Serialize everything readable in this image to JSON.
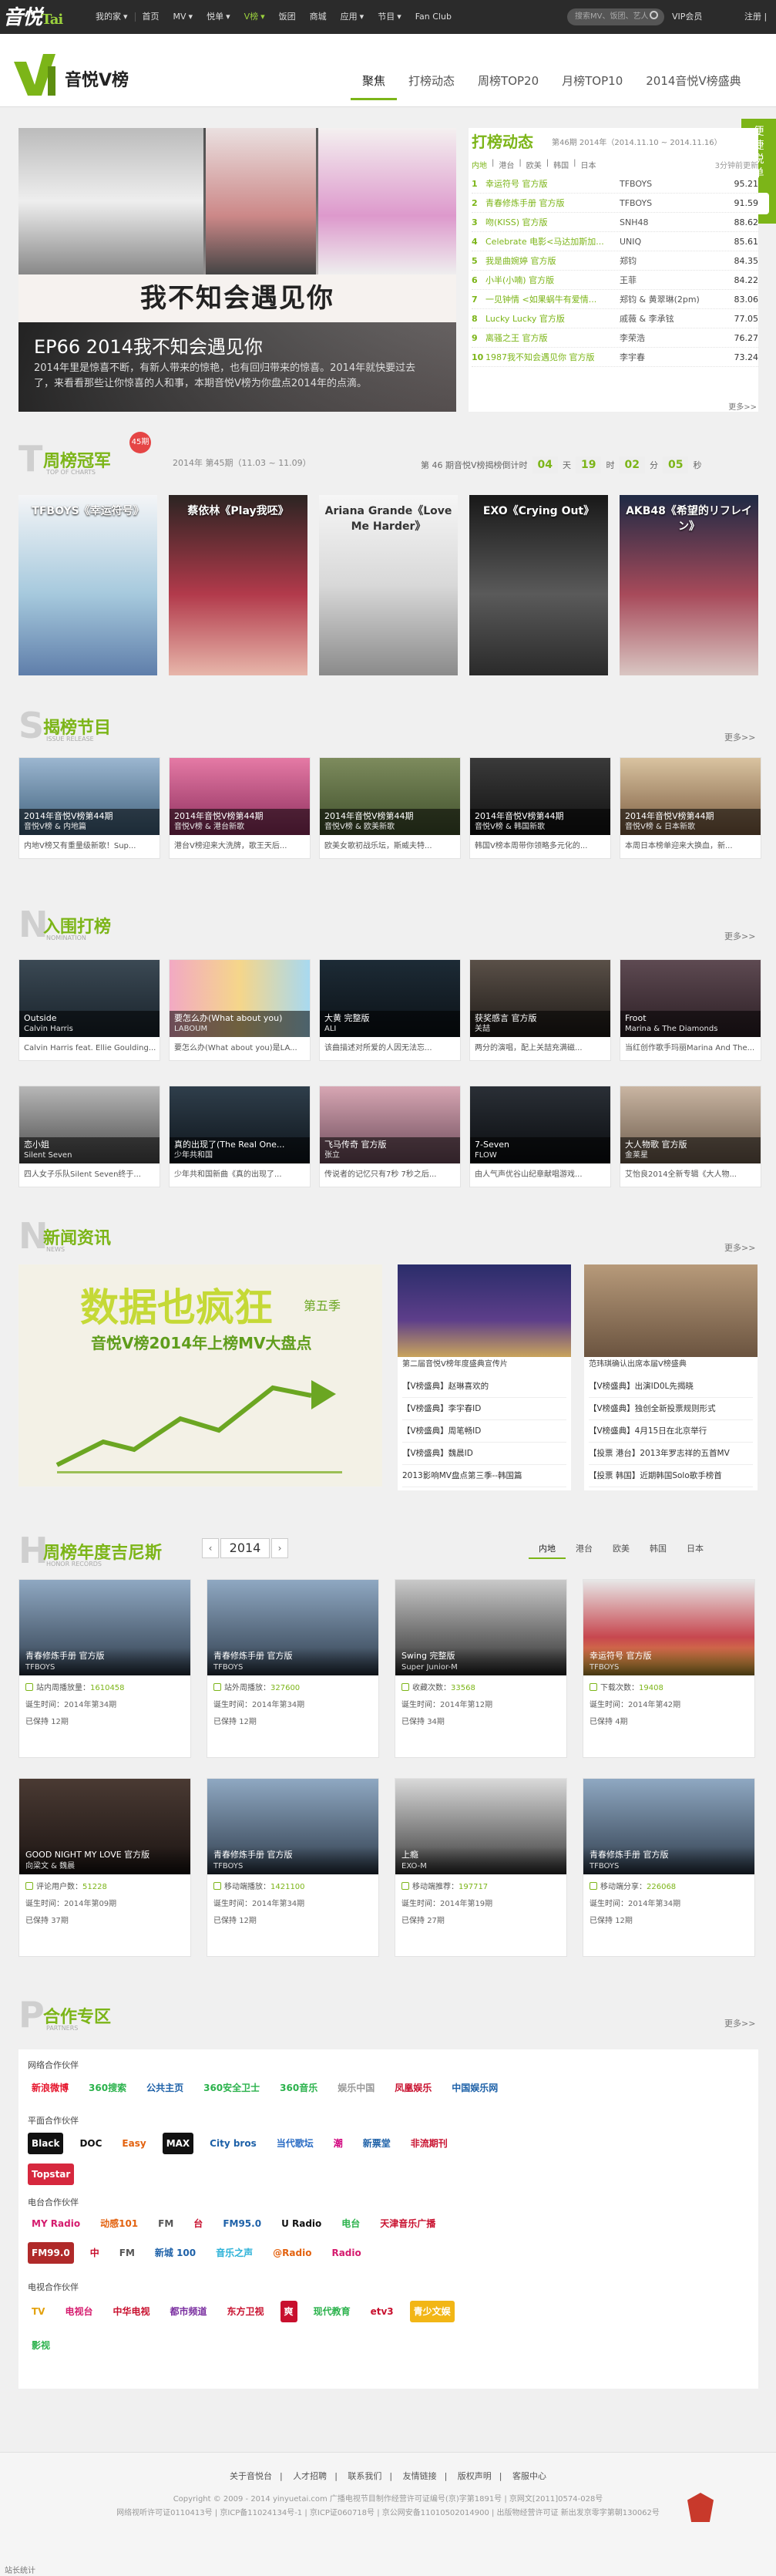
{
  "nav": {
    "logo": "音悦",
    "logo_suffix": "Tai",
    "items": [
      "我的家",
      "首页",
      "MV",
      "悦单",
      "V榜",
      "饭团",
      "商城",
      "应用",
      "节目",
      "Fan Club"
    ],
    "search_placeholder": "搜索MV、饭团、艺人",
    "vip": "VIP会员",
    "register": "注册",
    "login": "登录"
  },
  "header": {
    "title": "音悦V榜",
    "tabs": [
      "聚焦",
      "打榜动态",
      "周榜TOP20",
      "月榜TOP10",
      "2014音悦V榜盛典"
    ]
  },
  "float": {
    "label": "便捷悦单"
  },
  "hero": {
    "art_title": "我不知会遇见你",
    "title": "EP66 2014我不知会遇见你",
    "desc": "2014年里是惊喜不断，有新人带来的惊艳，也有回归带来的惊喜。2014年就快要过去了，来看看那些让你惊喜的人和事，本期音悦V榜为你盘点2014年的点滴。"
  },
  "rank": {
    "title": "打榜动态",
    "period": "第46期 2014年（2014.11.10 ~ 2014.11.16）",
    "regions": [
      "内地",
      "港台",
      "欧美",
      "韩国",
      "日本"
    ],
    "updated": "3分钟前更新",
    "rows": [
      {
        "n": "1",
        "song": "幸运符号 官方版",
        "artist": "TFBOYS",
        "score": "95.21"
      },
      {
        "n": "2",
        "song": "青春修炼手册 官方版",
        "artist": "TFBOYS",
        "score": "91.59"
      },
      {
        "n": "3",
        "song": "吻(KISS) 官方版",
        "artist": "SNH48",
        "score": "88.62"
      },
      {
        "n": "4",
        "song": "Celebrate 电影<马达加斯加...",
        "artist": "UNIQ",
        "score": "85.61"
      },
      {
        "n": "5",
        "song": "我是曲婉婷 官方版",
        "artist": "郑钧",
        "score": "84.35"
      },
      {
        "n": "6",
        "song": "小半(小喃) 官方版",
        "artist": "王菲",
        "score": "84.22"
      },
      {
        "n": "7",
        "song": "一见钟情 <如果蜗牛有爱情...",
        "artist": "郑钧 & 黄翠琳(2pm)",
        "score": "83.06"
      },
      {
        "n": "8",
        "song": "Lucky Lucky 官方版",
        "artist": "戚薇 & 李承铉",
        "score": "77.05"
      },
      {
        "n": "9",
        "song": "离骚之王 官方版",
        "artist": "李荣浩",
        "score": "76.27"
      },
      {
        "n": "10",
        "song": "1987我不知会遇见你 官方版",
        "artist": "李宇春",
        "score": "73.24"
      }
    ],
    "more": "更多>>"
  },
  "weekly": {
    "title_cn": "周榜冠军",
    "title_en": "TOP OF CHARTS",
    "badge": "45期",
    "period": "2014年 第45期（11.03 ~ 11.09）",
    "countdown_label": "第 46 期音悦V榜揭榜倒计时",
    "days": "04",
    "days_unit": "天",
    "hours": "19",
    "hours_unit": "时",
    "mins": "02",
    "mins_unit": "分",
    "secs": "05",
    "secs_unit": "秒",
    "champions": [
      {
        "label": "TFBOYS《幸运符号》"
      },
      {
        "label": "蔡依林《Play我呸》"
      },
      {
        "label": "Ariana Grande《Love Me Harder》"
      },
      {
        "label": "EXO《Crying Out》"
      },
      {
        "label": "AKB48《希望的リフレイン》"
      }
    ]
  },
  "programs": {
    "title_cn": "揭榜节目",
    "title_en": "ISSUE RELEASE",
    "more": "更多>>",
    "items": [
      {
        "ov": "2014年音悦V榜第44期",
        "sub": "音悦V榜 & 内地篇",
        "desc": "内地V榜又有重量级新歌！Sup..."
      },
      {
        "ov": "2014年音悦V榜第44期",
        "sub": "音悦V榜 & 港台新歌",
        "desc": "港台V榜迎来大洗牌，歌王天后..."
      },
      {
        "ov": "2014年音悦V榜第44期",
        "sub": "音悦V榜 & 欧美新歌",
        "desc": "欧美女歌初战乐坛，斯威夫特..."
      },
      {
        "ov": "2014年音悦V榜第44期",
        "sub": "音悦V榜 & 韩国新歌",
        "desc": "韩国V榜本周带你领略多元化的..."
      },
      {
        "ov": "2014年音悦V榜第44期",
        "sub": "音悦V榜 & 日本新歌",
        "desc": "本周日本榜单迎来大换血，新..."
      }
    ]
  },
  "candidates": {
    "title_cn": "入围打榜",
    "title_en": "NOMINATION",
    "more": "更多>>",
    "items": [
      {
        "ov": "Outside",
        "sub": "Calvin Harris",
        "desc": "Calvin Harris feat. Ellie Goulding..."
      },
      {
        "ov": "要怎么办(What about you)",
        "sub": "LABOUM",
        "desc": "要怎么办(What about you)是LA..."
      },
      {
        "ov": "大黄 完整版",
        "sub": "ALI",
        "desc": "该曲描述对所爱的人因无法忘..."
      },
      {
        "ov": "获奖感言 官方版",
        "sub": "关喆",
        "desc": "两分的演唱，配上关喆充满磁..."
      },
      {
        "ov": "Froot",
        "sub": "Marina & The Diamonds",
        "desc": "当红创作歌手玛丽Marina And The..."
      },
      {
        "ov": "恋小姐",
        "sub": "Silent Seven",
        "desc": "四人女子乐队Silent Seven终于..."
      },
      {
        "ov": "真的出现了(The Real One...",
        "sub": "少年共和国",
        "desc": "少年共和国新曲《真的出现了..."
      },
      {
        "ov": "飞马传奇 官方版",
        "sub": "张立",
        "desc": "传说者的记忆只有7秒 7秒之后..."
      },
      {
        "ov": "7-Seven",
        "sub": "FLOW",
        "desc": "由人气声优谷山纪章献唱游戏..."
      },
      {
        "ov": "大人物歌 官方版",
        "sub": "金莱星",
        "desc": "艾怡良2014全新专辑《大人物..."
      }
    ]
  },
  "news": {
    "title_cn": "新闻资讯",
    "title_en": "NEWS",
    "more": "更多>>",
    "big_t1": "数据也疯狂",
    "big_t2": "音悦V榜2014年上榜MV大盘点",
    "big_t3": "第五季",
    "col1_cap": "第二届音悦V榜年度盛典宣传片",
    "col1_items": [
      "【V榜盛典】赵琳喜欢的",
      "【V榜盛典】李宇春ID",
      "【V榜盛典】周笔畅ID",
      "【V榜盛典】魏晨ID",
      "2013影响MV盘点第三季--韩国篇"
    ],
    "col2_cap": "范玮琪确认出席本届V榜盛典",
    "col2_items": [
      "【V榜盛典】出演ID0L先揭晓",
      "【V榜盛典】独创全新投票规则形式",
      "【V榜盛典】4月15日在北京举行",
      "【投票 港台】2013年罗志祥的五首MV",
      "【投票 韩国】近期韩国Solo歌手榜首"
    ]
  },
  "guinness": {
    "title_cn": "周榜年度吉尼斯",
    "title_en": "HONOR RECORDS",
    "year": "2014",
    "prev": "‹",
    "next": "›",
    "regions": [
      "内地",
      "港台",
      "欧美",
      "韩国",
      "日本"
    ],
    "cards": [
      {
        "ov": "青春修炼手册 官方版",
        "sub": "TFBOYS",
        "k1": "站内周播放量：",
        "v1": "1610458",
        "k2": "诞生时间：",
        "v2": "2014年第34期",
        "k3": "已保持",
        "v3": "12期"
      },
      {
        "ov": "青春修炼手册 官方版",
        "sub": "TFBOYS",
        "k1": "站外周播放：",
        "v1": "327600",
        "k2": "诞生时间：",
        "v2": "2014年第34期",
        "k3": "已保持",
        "v3": "12期"
      },
      {
        "ov": "Swing 完整版",
        "sub": "Super Junior-M",
        "k1": "收藏次数：",
        "v1": "33568",
        "k2": "诞生时间：",
        "v2": "2014年第12期",
        "k3": "已保持",
        "v3": "34期"
      },
      {
        "ov": "幸运符号 官方版",
        "sub": "TFBOYS",
        "k1": "下载次数：",
        "v1": "19408",
        "k2": "诞生时间：",
        "v2": "2014年第42期",
        "k3": "已保持",
        "v3": "4期"
      },
      {
        "ov": "GOOD NIGHT MY LOVE 官方版",
        "sub": "向梁文 & 魏晨",
        "k1": "评论用户数：",
        "v1": "51228",
        "k2": "诞生时间：",
        "v2": "2014年第09期",
        "k3": "已保持",
        "v3": "37期"
      },
      {
        "ov": "青春修炼手册 官方版",
        "sub": "TFBOYS",
        "k1": "移动端播放：",
        "v1": "1421100",
        "k2": "诞生时间：",
        "v2": "2014年第34期",
        "k3": "已保持",
        "v3": "12期"
      },
      {
        "ov": "上瘾",
        "sub": "EXO-M",
        "k1": "移动端推荐：",
        "v1": "197717",
        "k2": "诞生时间：",
        "v2": "2014年第19期",
        "k3": "已保持",
        "v3": "27期"
      },
      {
        "ov": "青春修炼手册 官方版",
        "sub": "TFBOYS",
        "k1": "移动端分享：",
        "v1": "226068",
        "k2": "诞生时间：",
        "v2": "2014年第34期",
        "k3": "已保持",
        "v3": "12期"
      }
    ]
  },
  "partners": {
    "title_cn": "合作专区",
    "title_en": "PARTNERS",
    "more": "更多>>",
    "group1": "网络合作伙伴",
    "g1": [
      "新浪微博",
      "360搜索",
      "公共主页",
      "360安全卫士",
      "360音乐",
      "娱乐中国",
      "凤凰娱乐",
      "中国娱乐网"
    ],
    "group2": "平面合作伙伴",
    "g2": [
      "Black",
      "DOC",
      "Easy",
      "MAX",
      "City bros",
      "当代歌坛",
      "潮",
      "新票堂",
      "非流期刊",
      "Topstar"
    ],
    "group3": "电台合作伙伴",
    "g3": [
      "MY Radio",
      "动感101",
      "FM",
      "台",
      "FM95.0",
      "U Radio",
      "电台",
      "天津音乐广播",
      "FM",
      "FM99.0"
    ],
    "g3b": [
      "中",
      "FM",
      "新城 100",
      "音乐之声",
      "@Radio",
      "Radio"
    ],
    "group4": "电视合作伙伴",
    "g4": [
      "TV",
      "电视台",
      "中华电视",
      "都市频道",
      "东方卫视",
      "爽",
      "现代教育",
      "etv3",
      "青少文娱",
      "影视"
    ]
  },
  "footer": {
    "links": [
      "关于音悦台",
      "人才招聘",
      "联系我们",
      "友情链接",
      "版权声明",
      "客服中心"
    ],
    "copy1": "Copyright © 2009 - 2014 yinyuetai.com 广播电视节目制作经营许可证编号(京)字第1891号 | 京网文[2011]0574-028号",
    "copy2": "网络视听许可证0110413号 | 京ICP备11024134号-1 | 京ICP证060718号 | 京公网安备11010502014900 | 出版物经营许可证 新出发京零字第朝130062号",
    "stat": "站长统计"
  },
  "colors": {
    "accent": "#7cb518",
    "nav_bg": "#2b2b2b",
    "badge": "#e54545"
  }
}
